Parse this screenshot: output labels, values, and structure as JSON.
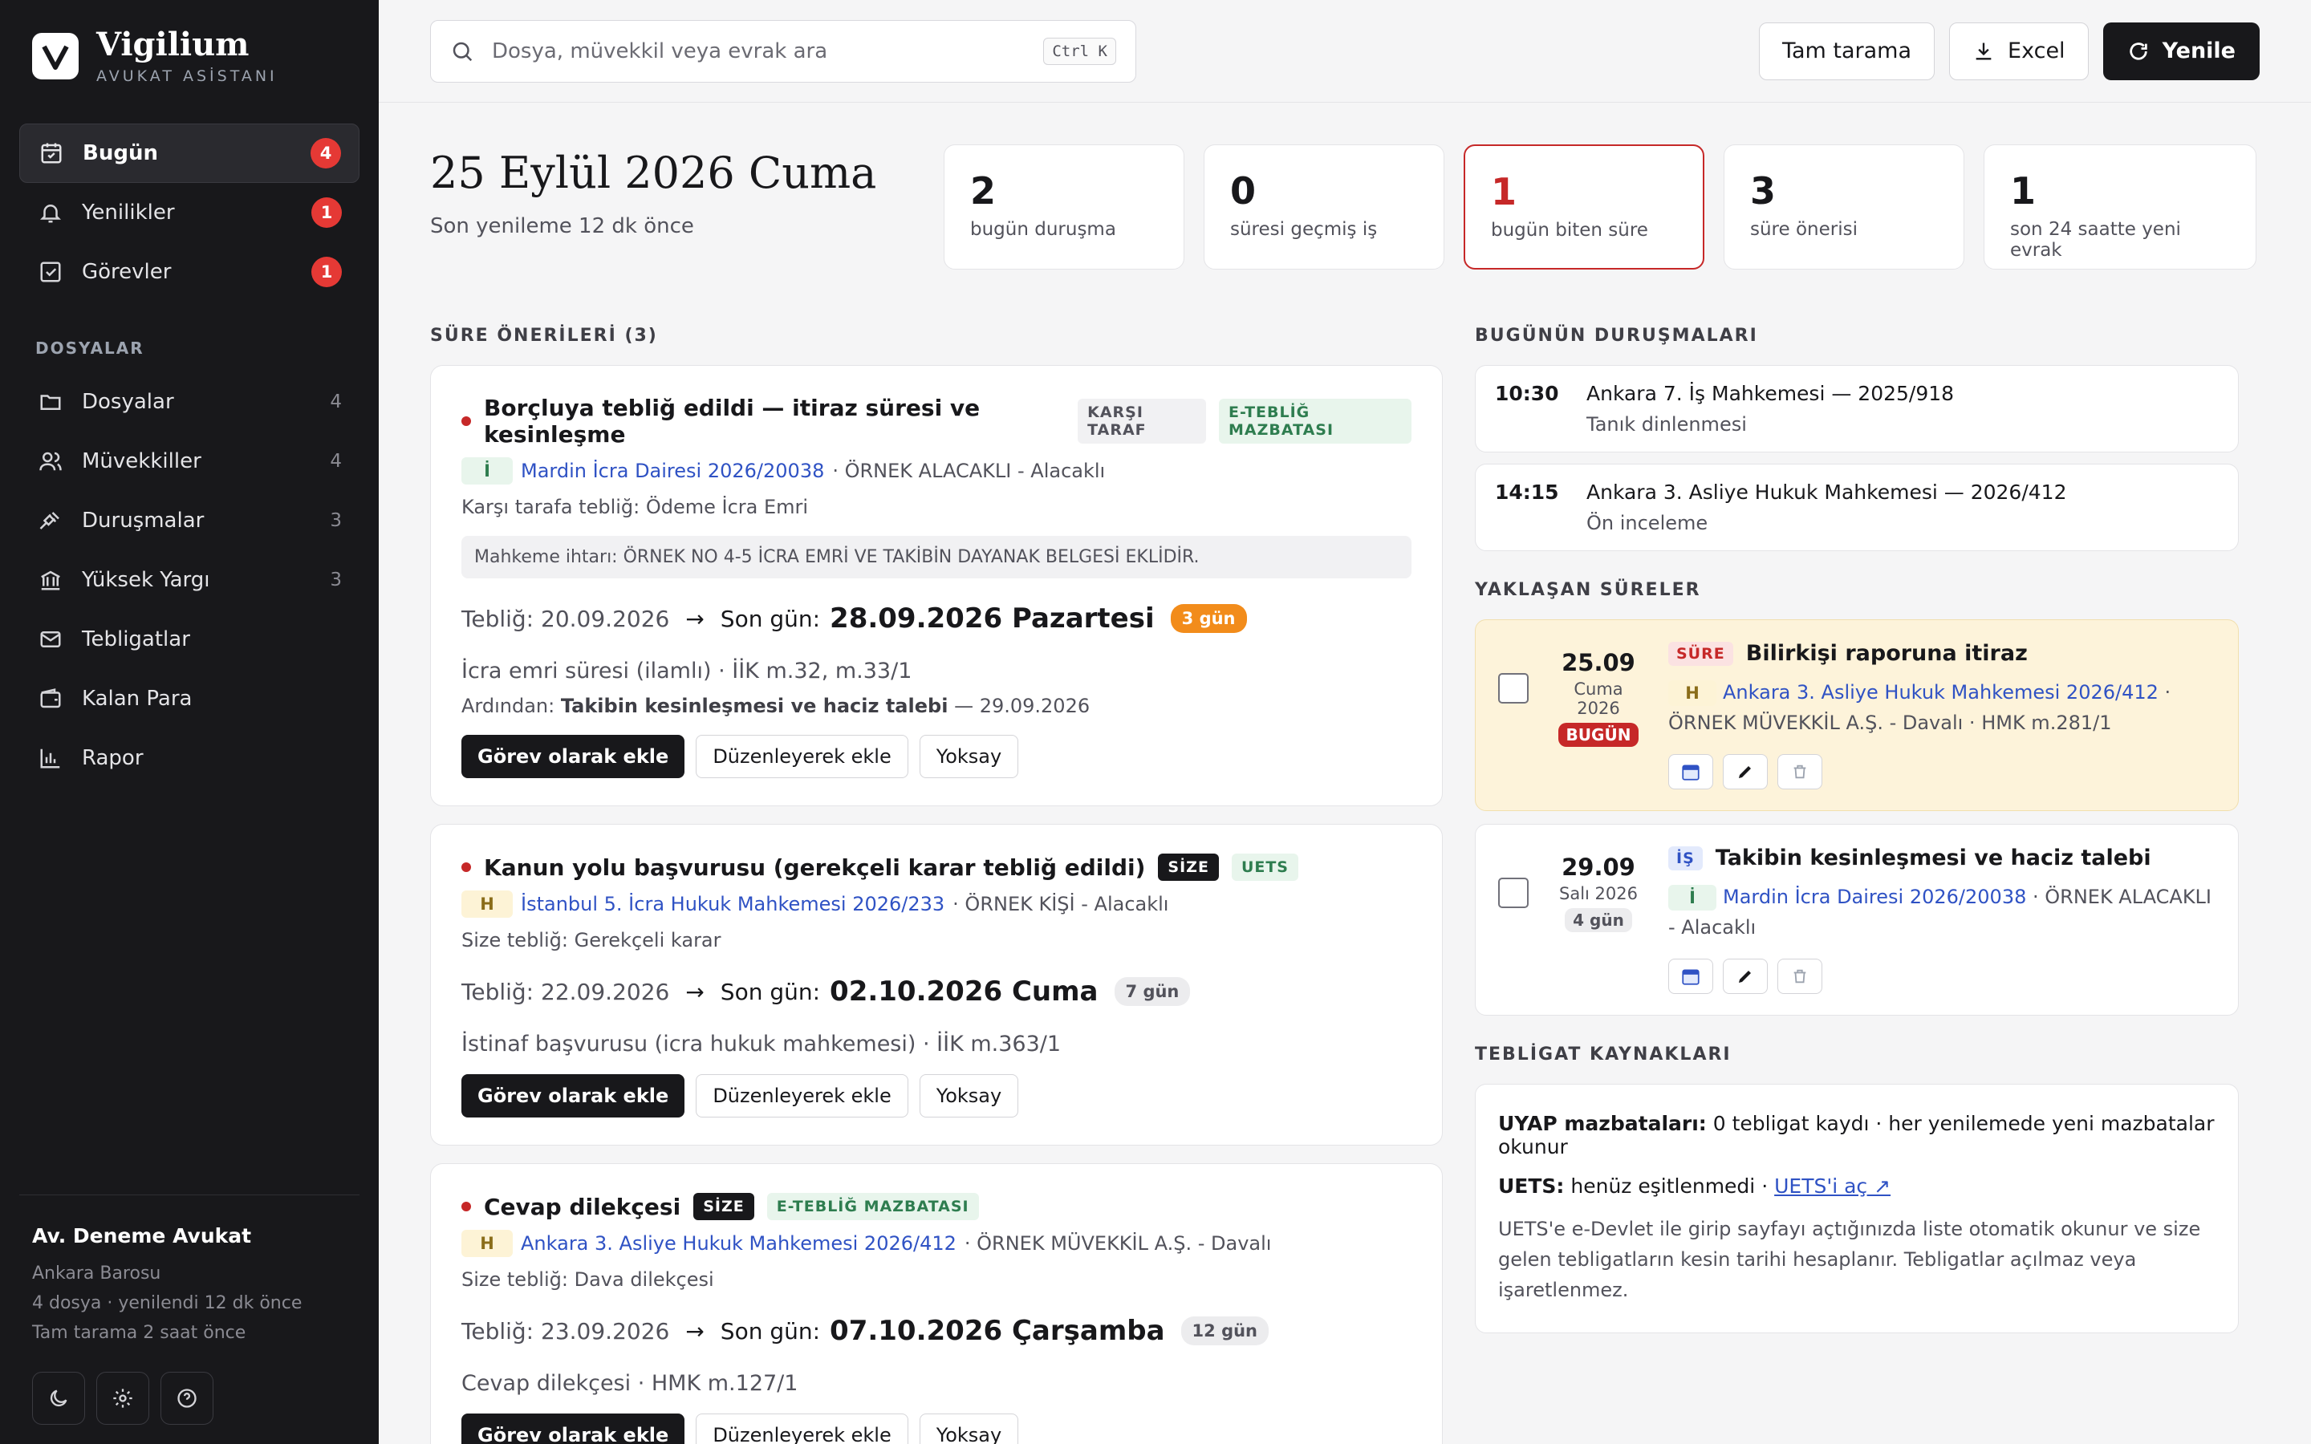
{
  "brand": {
    "name": "Vigilium",
    "subtitle": "AVUKAT ASİSTANI",
    "logo_letter": "V"
  },
  "sidebar": {
    "top_items": [
      {
        "label": "Bugün",
        "badge": "4",
        "icon": "calendar-icon",
        "active": true
      },
      {
        "label": "Yenilikler",
        "badge": "1",
        "icon": "bell-icon"
      },
      {
        "label": "Görevler",
        "badge": "1",
        "icon": "checkbox-icon"
      }
    ],
    "section_label": "DOSYALAR",
    "file_items": [
      {
        "label": "Dosyalar",
        "count": "4",
        "icon": "folder-icon"
      },
      {
        "label": "Müvekkiller",
        "count": "4",
        "icon": "users-icon"
      },
      {
        "label": "Duruşmalar",
        "count": "3",
        "icon": "gavel-icon"
      },
      {
        "label": "Yüksek Yargı",
        "count": "3",
        "icon": "courthouse-icon"
      },
      {
        "label": "Tebligatlar",
        "count": "",
        "icon": "mail-icon"
      },
      {
        "label": "Kalan Para",
        "count": "",
        "icon": "wallet-icon"
      },
      {
        "label": "Rapor",
        "count": "",
        "icon": "bar-chart-icon"
      }
    ],
    "user": {
      "name": "Av. Deneme Avukat",
      "bar": "Ankara Barosu",
      "meta1": "4 dosya · yenilendi 12 dk önce",
      "meta2": "Tam tarama 2 saat önce"
    }
  },
  "topbar": {
    "search_placeholder": "Dosya, müvekkil veya evrak ara",
    "shortcut": "Ctrl K",
    "full_scan": "Tam tarama",
    "excel": "Excel",
    "refresh": "Yenile"
  },
  "header": {
    "date": "25 Eylül 2026 Cuma",
    "last_refresh": "Son yenileme 12 dk önce"
  },
  "stats": [
    {
      "value": "2",
      "label": "bugün duruşma"
    },
    {
      "value": "0",
      "label": "süresi geçmiş iş"
    },
    {
      "value": "1",
      "label": "bugün biten süre",
      "alert": true
    },
    {
      "value": "3",
      "label": "süre önerisi"
    },
    {
      "value": "1",
      "label": "son 24 saatte yeni evrak"
    }
  ],
  "suggestions": {
    "title": "SÜRE ÖNERİLERİ (3)",
    "items": [
      {
        "title": "Borçluya tebliğ edildi — itiraz süresi ve kesinleşme",
        "tags": [
          {
            "text": "KARŞI TARAF",
            "style": "grey"
          },
          {
            "text": "E-TEBLİĞ MAZBATASI",
            "style": "green"
          }
        ],
        "court_chip": "İ",
        "chip_style": "green",
        "court_ref": "Mardin İcra Dairesi 2026/20038",
        "party": "· ÖRNEK ALACAKLI - Alacaklı",
        "served": "Karşı tarafa tebliğ: Ödeme İcra Emri",
        "notice": "Mahkeme ihtarı: ÖRNEK NO 4-5 İCRA EMRİ VE TAKİBİN DAYANAK BELGESİ EKLİDİR.",
        "teblig_date": "Tebliğ: 20.09.2026",
        "son_gun_label": "Son gün:",
        "son_gun": "28.09.2026 Pazartesi",
        "days": "3 gün",
        "days_style": "orange",
        "rule": "İcra emri süresi (ilamlı) · İİK m.32, m.33/1",
        "after_label": "Ardından:",
        "after_bold": "Takibin kesinleşmesi ve haciz talebi",
        "after_date": "— 29.09.2026"
      },
      {
        "title": "Kanun yolu başvurusu (gerekçeli karar tebliğ edildi)",
        "tags": [
          {
            "text": "SİZE",
            "style": "black"
          },
          {
            "text": "UETS",
            "style": "green"
          }
        ],
        "court_chip": "H",
        "chip_style": "yellow",
        "court_ref": "İstanbul 5. İcra Hukuk Mahkemesi 2026/233",
        "party": "· ÖRNEK KİŞİ - Alacaklı",
        "served": "Size tebliğ: Gerekçeli karar",
        "teblig_date": "Tebliğ: 22.09.2026",
        "son_gun_label": "Son gün:",
        "son_gun": "02.10.2026 Cuma",
        "days": "7 gün",
        "days_style": "grey",
        "rule": "İstinaf başvurusu (icra hukuk mahkemesi) · İİK m.363/1"
      },
      {
        "title": "Cevap dilekçesi",
        "tags": [
          {
            "text": "SİZE",
            "style": "black"
          },
          {
            "text": "E-TEBLİĞ MAZBATASI",
            "style": "green"
          }
        ],
        "court_chip": "H",
        "chip_style": "yellow",
        "court_ref": "Ankara 3. Asliye Hukuk Mahkemesi 2026/412",
        "party": "· ÖRNEK MÜVEKKİL A.Ş. - Davalı",
        "served": "Size tebliğ: Dava dilekçesi",
        "teblig_date": "Tebliğ: 23.09.2026",
        "son_gun_label": "Son gün:",
        "son_gun": "07.10.2026 Çarşamba",
        "days": "12 gün",
        "days_style": "grey",
        "rule": "Cevap dilekçesi · HMK m.127/1"
      }
    ],
    "buttons": {
      "add_task": "Görev olarak ekle",
      "edit_add": "Düzenleyerek ekle",
      "ignore": "Yoksay"
    }
  },
  "hearings": {
    "title": "BUGÜNÜN DURUŞMALARI",
    "items": [
      {
        "time": "10:30",
        "court": "Ankara 7. İş Mahkemesi — 2025/918",
        "desc": "Tanık dinlenmesi"
      },
      {
        "time": "14:15",
        "court": "Ankara 3. Asliye Hukuk Mahkemesi — 2026/412",
        "desc": "Ön inceleme"
      }
    ]
  },
  "deadlines": {
    "title": "YAKLAŞAN SÜRELER",
    "items": [
      {
        "day": "25.09",
        "week": "Cuma 2026",
        "badge": "BUGÜN",
        "type": "SÜRE",
        "title": "Bilirkişi raporuna itiraz",
        "chip": "H",
        "court_ref": "Ankara 3. Asliye Hukuk Mahkemesi 2026/412",
        "rest": "· ÖRNEK MÜVEKKİL A.Ş. - Davalı · HMK m.281/1"
      },
      {
        "day": "29.09",
        "week": "Salı 2026",
        "badge": "4 gün",
        "type": "İŞ",
        "title": "Takibin kesinleşmesi ve haciz talebi",
        "chip": "İ",
        "court_ref": "Mardin İcra Dairesi 2026/20038",
        "rest": "· ÖRNEK ALACAKLI - Alacaklı"
      }
    ]
  },
  "sources": {
    "title": "TEBLİGAT KAYNAKLARI",
    "uyap_label": "UYAP mazbataları:",
    "uyap_text": "0 tebligat kaydı · her yenilemede yeni mazbatalar okunur",
    "uets_label": "UETS:",
    "uets_text": "henüz eşitlenmedi ·",
    "uets_link": "UETS'i aç ↗",
    "note": "UETS'e e-Devlet ile girip sayfayı açtığınızda liste otomatik okunur ve size gelen tebligatların kesin tarihi hesaplanır. Tebligatlar açılmaz veya işaretlenmez."
  },
  "colors": {
    "sidebar": "#18181b",
    "accent_red": "#c62828",
    "link": "#2f52c4",
    "today_bg": "#fdf3da"
  }
}
